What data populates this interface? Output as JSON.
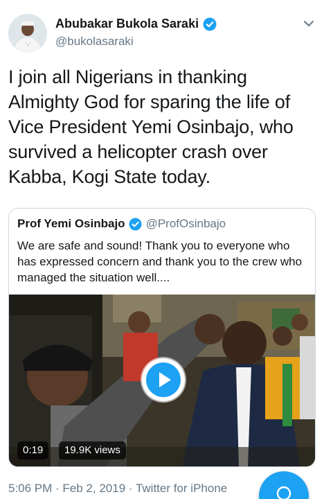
{
  "author": {
    "display_name": "Abubakar Bukola Saraki",
    "handle": "@bukolasaraki"
  },
  "tweet": {
    "text": "I join all Nigerians in thanking Almighty God for sparing the life of Vice President Yemi Osinbajo, who survived a helicopter crash over Kabba, Kogi State today."
  },
  "quoted": {
    "display_name": "Prof Yemi Osinbajo",
    "handle": "@ProfOsinbajo",
    "text": "We are safe and sound! Thank you to everyone who has expressed concern and thank you to the crew who managed the situation well....",
    "video": {
      "duration": "0:19",
      "views": "19.9K views"
    }
  },
  "meta": {
    "timestamp": "5:06 PM · Feb 2, 2019 · Twitter for iPhone"
  },
  "icons": {
    "verified": "verified-badge-icon",
    "menu": "chevron-down-icon",
    "play": "play-icon",
    "compose": "compose-icon"
  },
  "colors": {
    "accent": "#1da1f2",
    "text": "#14171a",
    "secondary": "#657786",
    "border": "#ccd6dd"
  }
}
